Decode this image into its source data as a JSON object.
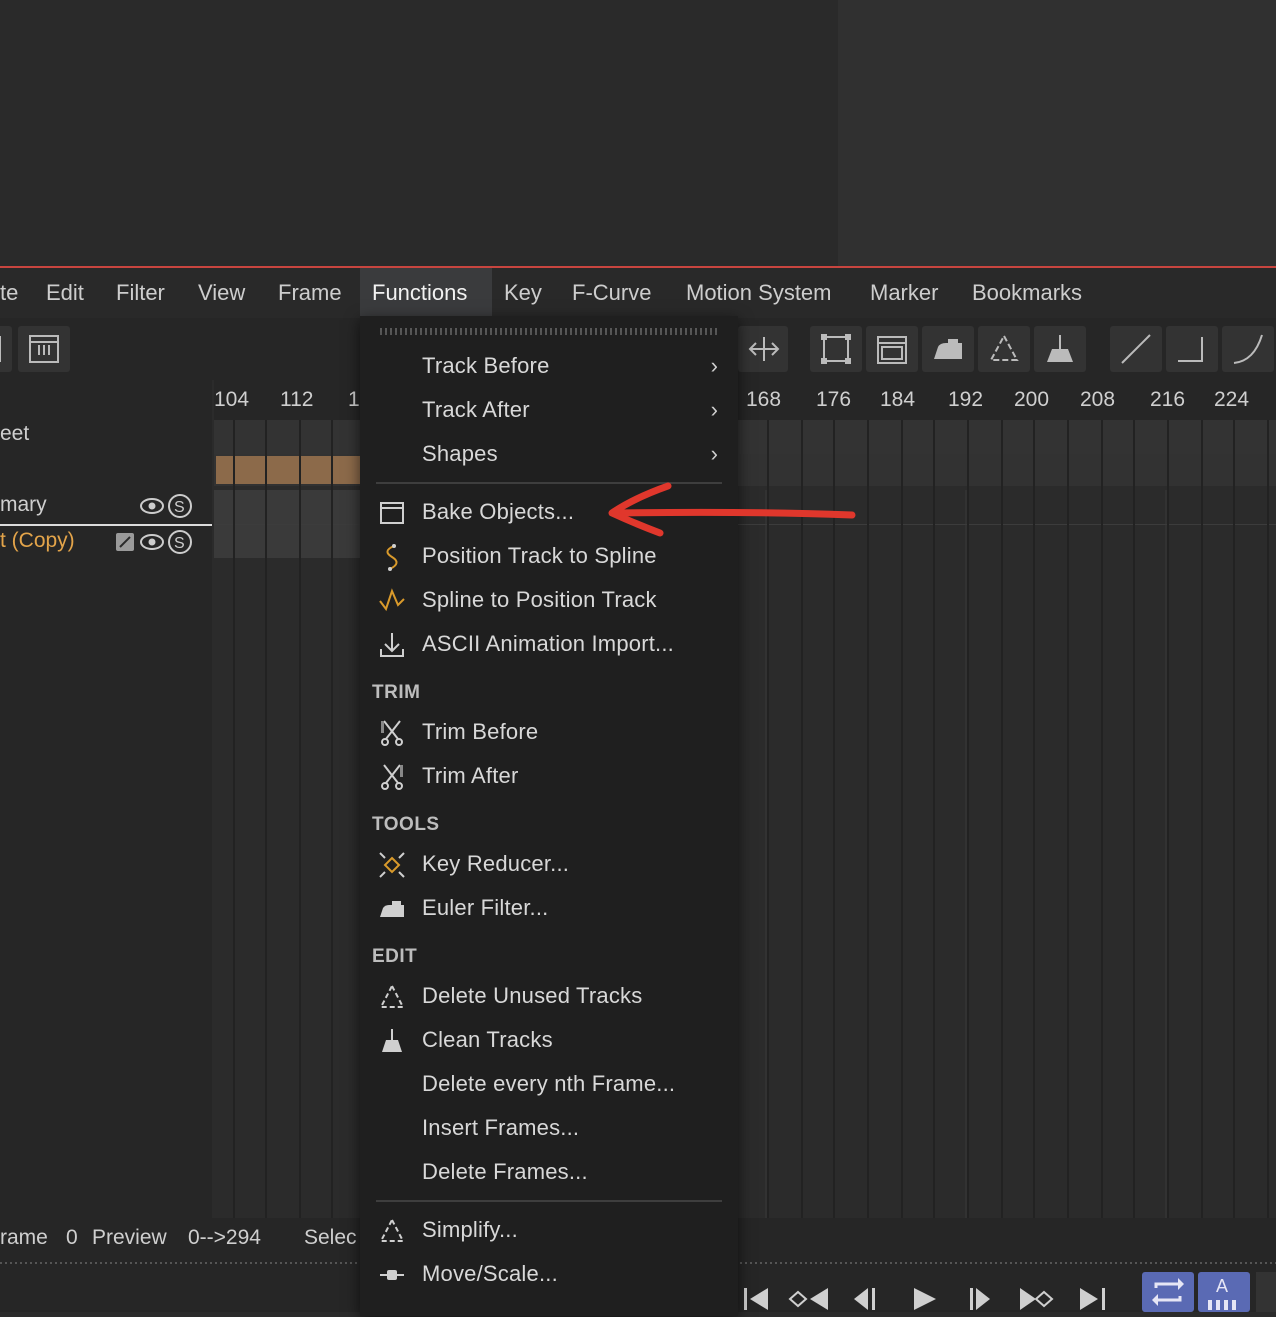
{
  "menubar": {
    "items": [
      "te",
      "Edit",
      "Filter",
      "View",
      "Frame",
      "Functions",
      "Key",
      "F-Curve",
      "Motion System",
      "Marker",
      "Bookmarks"
    ],
    "active": "Functions"
  },
  "ruler": {
    "left_labels": [
      "104",
      "112",
      "1"
    ],
    "right_labels": [
      "168",
      "176",
      "184",
      "192",
      "200",
      "208",
      "216",
      "224"
    ]
  },
  "objects": {
    "row1": "eet",
    "row2": "mary",
    "row3": "t (Copy)"
  },
  "status": {
    "frame_label": "rame",
    "frame_value": "0",
    "preview_label": "Preview",
    "preview_value": "0-->294",
    "select_label": "Selec"
  },
  "functions_menu": {
    "submenus": [
      "Track Before",
      "Track After",
      "Shapes"
    ],
    "items_top": [
      "Bake Objects...",
      "Position Track to Spline",
      "Spline to Position Track",
      "ASCII Animation Import..."
    ],
    "trim_header": "TRIM",
    "trim_items": [
      "Trim Before",
      "Trim After"
    ],
    "tools_header": "TOOLS",
    "tools_items": [
      "Key Reducer...",
      "Euler Filter..."
    ],
    "edit_header": "EDIT",
    "edit_items": [
      "Delete Unused Tracks",
      "Clean Tracks",
      "Delete every nth Frame...",
      "Insert Frames...",
      "Delete Frames..."
    ],
    "bottom_items": [
      "Simplify...",
      "Move/Scale..."
    ]
  },
  "colors": {
    "accent_orange": "#e3a44a",
    "arrow_red": "#e0372c",
    "menu_bg": "#1f1f1f",
    "active_menu_bg": "#3a3b3d"
  },
  "icons": {
    "bake": "bake-icon",
    "position_to_spline": "position-to-spline-icon",
    "spline_to_position": "spline-to-position-icon",
    "import": "import-icon",
    "trim": "scissors-icon",
    "key_reducer": "key-reducer-icon",
    "euler": "iron-icon",
    "delete_unused": "recycle-icon",
    "clean": "broom-icon",
    "simplify": "recycle-icon",
    "move_scale": "move-scale-icon"
  }
}
